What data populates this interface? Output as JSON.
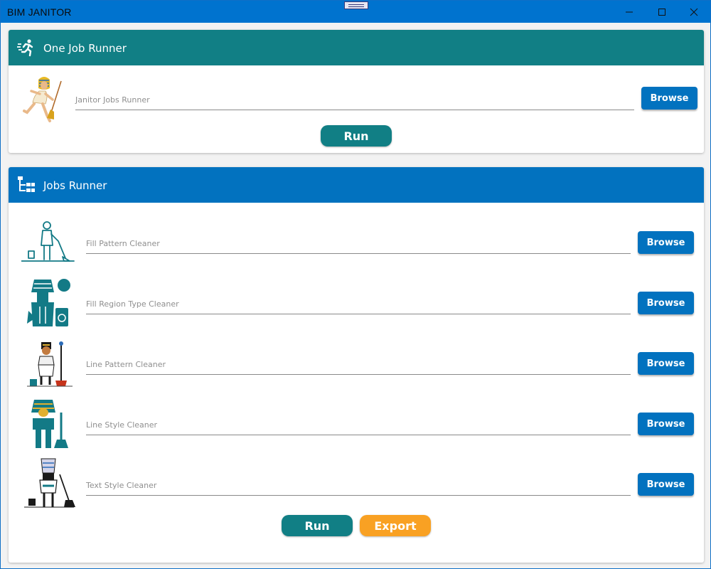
{
  "window": {
    "title": "BIM JANITOR",
    "accent": "#0073cf"
  },
  "one_job": {
    "title": "One Job Runner",
    "header_color": "#117f85",
    "header_icon": "running-person-icon",
    "field_placeholder": "Janitor Jobs Runner",
    "browse_label": "Browse",
    "run_label": "Run"
  },
  "jobs": {
    "title": "Jobs Runner",
    "header_color": "#0272bf",
    "header_icon": "tree-list-icon",
    "rows": [
      {
        "placeholder": "Fill Pattern Cleaner",
        "browse_label": "Browse",
        "icon": "janitor-mopping-icon"
      },
      {
        "placeholder": "Fill Region Type Cleaner",
        "browse_label": "Browse",
        "icon": "pharaoh-janitor-bin-icon"
      },
      {
        "placeholder": "Line Pattern Cleaner",
        "browse_label": "Browse",
        "icon": "egyptian-janitor-bucket-icon"
      },
      {
        "placeholder": "Line Style Cleaner",
        "browse_label": "Browse",
        "icon": "pharaoh-janitor-broom-icon"
      },
      {
        "placeholder": "Text Style Cleaner",
        "browse_label": "Browse",
        "icon": "nefertiti-janitor-sweeping-icon"
      }
    ],
    "run_label": "Run",
    "export_label": "Export",
    "export_color": "#f9a123"
  }
}
